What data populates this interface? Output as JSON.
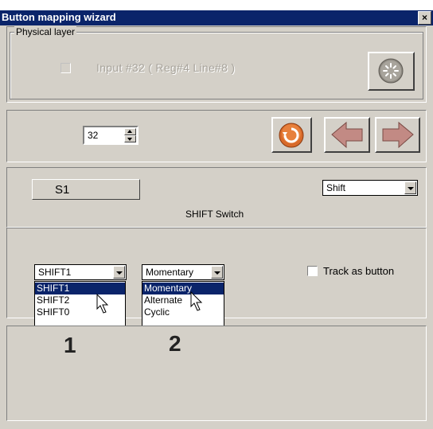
{
  "window": {
    "title": "Button mapping wizard",
    "close_glyph": "×"
  },
  "physical": {
    "legend": "Physical layer",
    "input_label": "Input #32  ( Reg#4  Line#8 )"
  },
  "nav": {
    "number_value": "32"
  },
  "mapping": {
    "button_label": "S1",
    "mode_select": "Shift",
    "description": "SHIFT Switch"
  },
  "dropdown1": {
    "value": "SHIFT1",
    "options": [
      "SHIFT1",
      "SHIFT2",
      "SHIFT0"
    ],
    "marker": "1"
  },
  "dropdown2": {
    "value": "Momentary",
    "options": [
      "Momentary",
      "Alternate",
      "Cyclic"
    ],
    "marker": "2"
  },
  "track": {
    "label": "Track as button"
  }
}
